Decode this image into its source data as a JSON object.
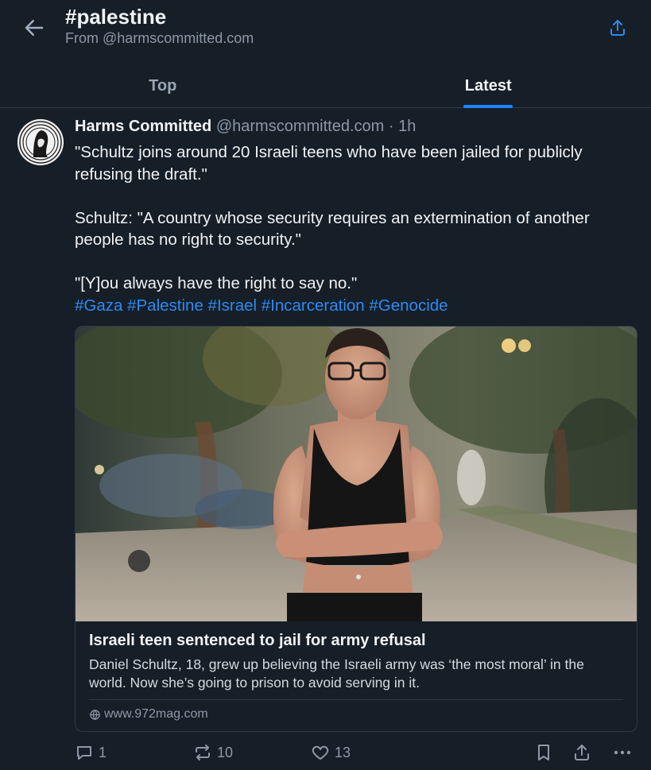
{
  "header": {
    "title": "#palestine",
    "subtitle": "From @harmscommitted.com",
    "back_icon": "arrow-left-icon",
    "share_icon": "share-icon"
  },
  "tabs": [
    {
      "label": "Top",
      "active": false
    },
    {
      "label": "Latest",
      "active": true
    }
  ],
  "post": {
    "author": "Harms Committed",
    "handle": "@harmscommitted.com",
    "time": "1h",
    "paragraphs": [
      "\"Schultz joins around 20 Israeli teens who have been jailed for publicly refusing the draft.\"",
      "Schultz: \"A country whose security requires an extermination of another people has no right to security.\"",
      "\"[Y]ou always have the right to say no.\""
    ],
    "hashtags": [
      "#Gaza",
      "#Palestine",
      "#Israel",
      "#Incarceration",
      "#Genocide"
    ],
    "link_card": {
      "title": "Israeli teen sentenced to jail for army refusal",
      "description": "Daniel Schultz, 18, grew up believing the Israeli army was ‘the most moral’ in the world. Now she’s going to prison to avoid serving in it.",
      "domain": "www.972mag.com"
    },
    "stats": {
      "replies": "1",
      "reposts": "10",
      "likes": "13"
    }
  },
  "colors": {
    "background": "#161e27",
    "accent": "#1d84ff",
    "link": "#2b8bf2",
    "muted": "#8d99a8"
  }
}
